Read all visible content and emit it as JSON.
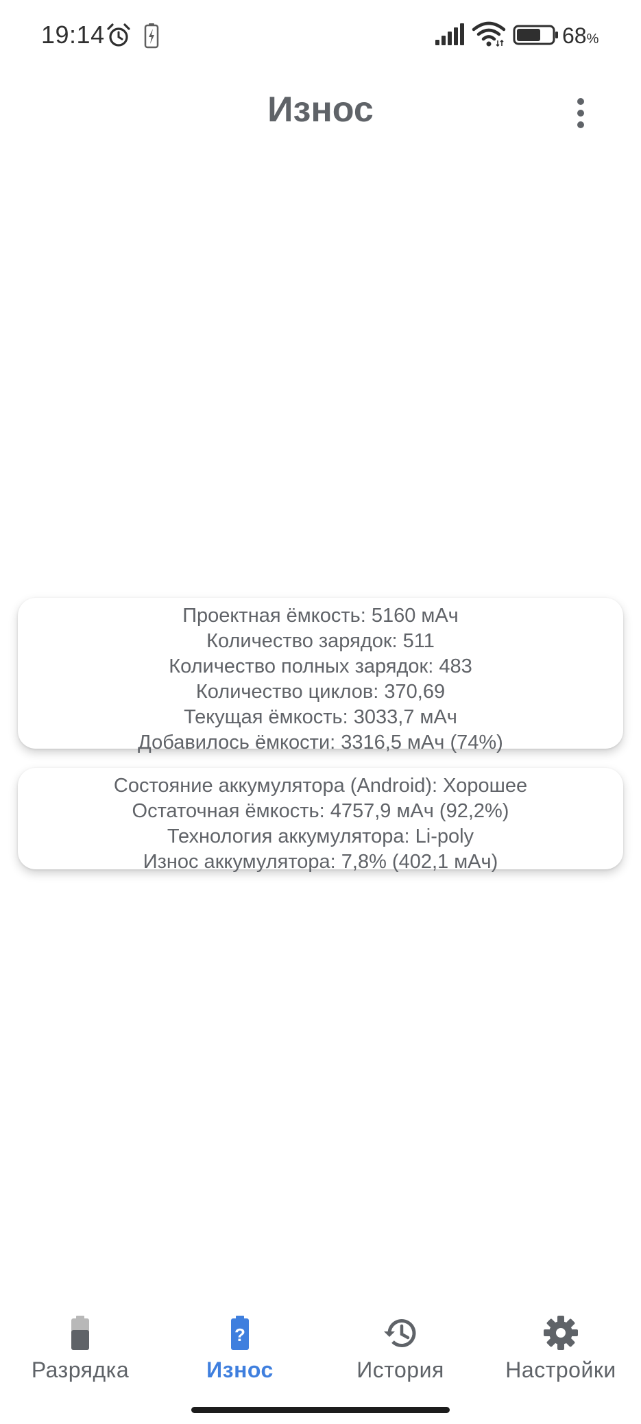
{
  "status_bar": {
    "time": "19:14",
    "battery_percent": "68",
    "battery_percent_sign": "%",
    "battery_level": 0.68,
    "icons": [
      "alarm-clock-icon",
      "battery-charging-icon",
      "cellular-signal-icon",
      "wifi-icon",
      "battery-icon"
    ]
  },
  "app_bar": {
    "title": "Износ",
    "menu_icon": "more-vert-icon"
  },
  "cards": {
    "capacity": {
      "lines": [
        "Проектная ёмкость: 5160 мАч",
        "Количество зарядок: 511",
        "Количество полных зарядок: 483",
        "Количество циклов: 370,69",
        "Текущая ёмкость: 3033,7 мАч",
        "Добавилось ёмкости: 3316,5 мАч (74%)"
      ]
    },
    "health": {
      "lines": [
        "Состояние аккумулятора (Android): Хорошее",
        "Остаточная ёмкость: 4757,9 мАч (92,2%)",
        "Технология аккумулятора: Li-poly",
        "Износ аккумулятора: 7,8% (402,1 мАч)"
      ]
    }
  },
  "bottom_nav": {
    "items": [
      {
        "label": "Разрядка",
        "icon": "battery-icon",
        "active": false
      },
      {
        "label": "Износ",
        "icon": "battery-unknown-icon",
        "active": true
      },
      {
        "label": "История",
        "icon": "history-icon",
        "active": false
      },
      {
        "label": "Настройки",
        "icon": "gear-icon",
        "active": false
      }
    ]
  },
  "colors": {
    "accent": "#3f7fde",
    "text": "#5f6368",
    "background": "#ffffff"
  }
}
